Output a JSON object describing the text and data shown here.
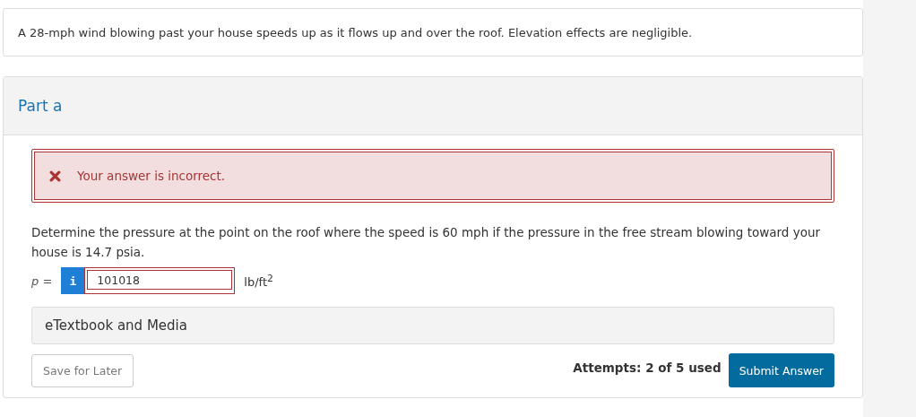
{
  "question": {
    "text": "A 28-mph wind blowing past your house speeds up as it flows up and over the roof. Elevation effects are negligible."
  },
  "part": {
    "title": "Part a",
    "feedback": {
      "kind": "incorrect",
      "text": "Your answer is incorrect."
    },
    "prompt": "Determine the pressure at the point on the roof where the speed is 60 mph if the pressure in the free stream blowing toward your house is 14.7 psia.",
    "answer": {
      "label": "*p* =",
      "info": "i",
      "value": "101018",
      "incorrect": true,
      "unit": "lb/ft$^{2}$"
    },
    "resources": {
      "label": "eTextbook and Media"
    },
    "save_button": "Save for Later",
    "attempts": "Attempts: 2 of 5 used",
    "submit_button": "Submit Answer"
  }
}
